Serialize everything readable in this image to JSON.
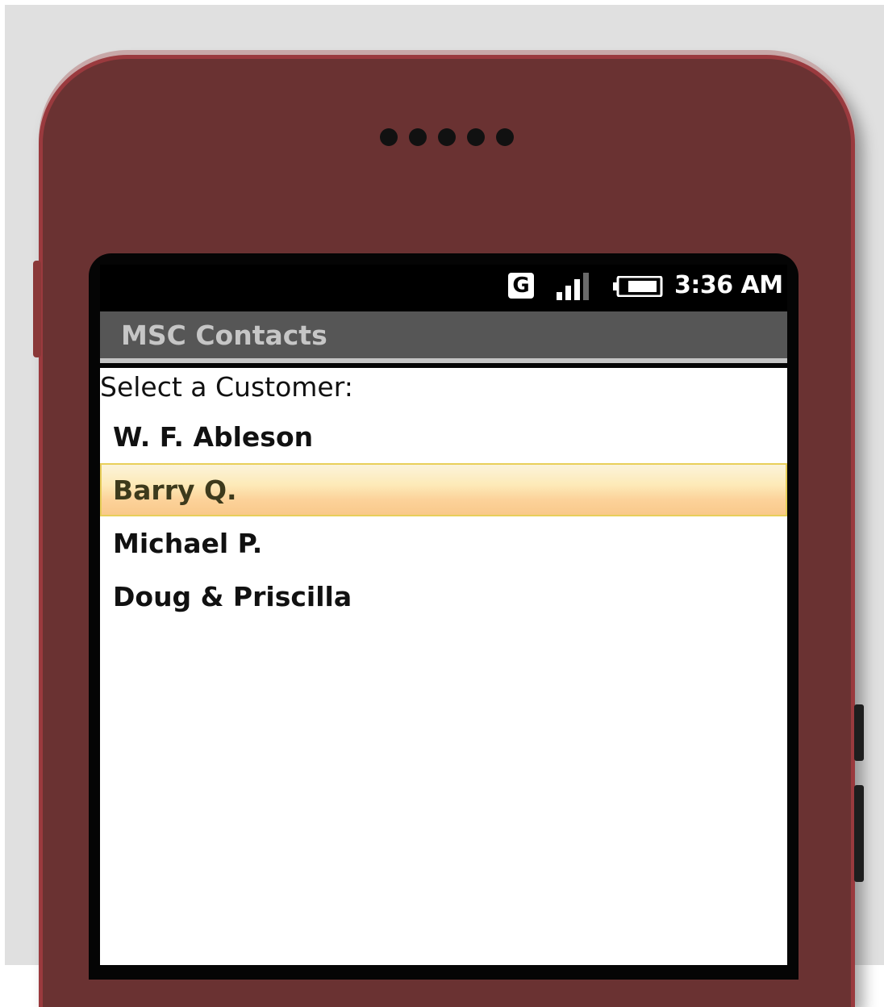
{
  "status_bar": {
    "network_label": "G",
    "time": "3:36 AM"
  },
  "app": {
    "title": "MSC Contacts"
  },
  "main": {
    "prompt": "Select a Customer:",
    "customers": [
      {
        "name": "W. F. Ableson",
        "selected": false
      },
      {
        "name": "Barry Q.",
        "selected": true
      },
      {
        "name": "Michael P.",
        "selected": false
      },
      {
        "name": "Doug & Priscilla",
        "selected": false
      }
    ]
  },
  "icons": {
    "network": "network-type-icon",
    "signal": "signal-strength-icon",
    "battery": "battery-icon"
  },
  "colors": {
    "phone_body": "#6a3232",
    "title_bar": "#565656",
    "selection_highlight": "#fcd29a",
    "selection_border": "#e8cf5a"
  }
}
